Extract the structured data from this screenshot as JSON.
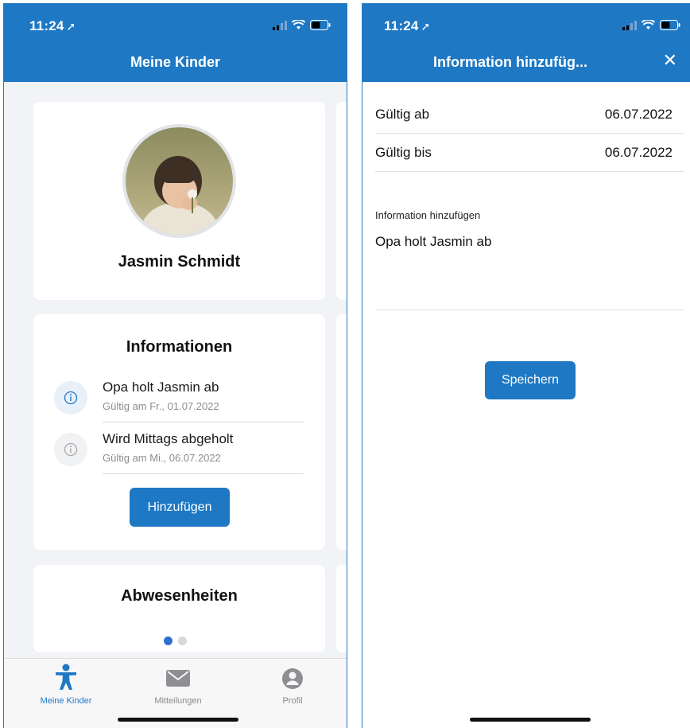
{
  "left_screen": {
    "status": {
      "time": "11:24"
    },
    "nav_title": "Meine Kinder",
    "child": {
      "name": "Jasmin Schmidt"
    },
    "informationen": {
      "title": "Informationen",
      "items": [
        {
          "text": "Opa holt Jasmin ab",
          "validity": "Gültig am Fr., 01.07.2022",
          "state": "active"
        },
        {
          "text": "Wird Mittags abgeholt",
          "validity": "Gültig am Mi., 06.07.2022",
          "state": "inactive"
        }
      ],
      "add_button": "Hinzufügen"
    },
    "abwesenheiten": {
      "title": "Abwesenheiten"
    },
    "page_dots": {
      "count": 2,
      "active_index": 0
    },
    "tabs": [
      {
        "label": "Meine Kinder",
        "icon": "child-figure-icon",
        "active": true
      },
      {
        "label": "Mitteilungen",
        "icon": "envelope-icon",
        "active": false
      },
      {
        "label": "Profil",
        "icon": "person-circle-icon",
        "active": false
      }
    ]
  },
  "right_screen": {
    "status": {
      "time": "11:24"
    },
    "nav_title": "Information hinzufüg...",
    "close_icon": "close-icon",
    "valid_from": {
      "label": "Gültig ab",
      "value": "06.07.2022"
    },
    "valid_to": {
      "label": "Gültig bis",
      "value": "06.07.2022"
    },
    "info_field": {
      "label": "Information hinzufügen",
      "value": "Opa holt Jasmin ab"
    },
    "save_button": "Speichern"
  },
  "colors": {
    "primary": "#1e78c4",
    "background": "#f2f3f6",
    "muted_text": "#8d8d8d",
    "active_dot": "#2f6fd0",
    "inactive_dot": "#d6d8dc"
  }
}
